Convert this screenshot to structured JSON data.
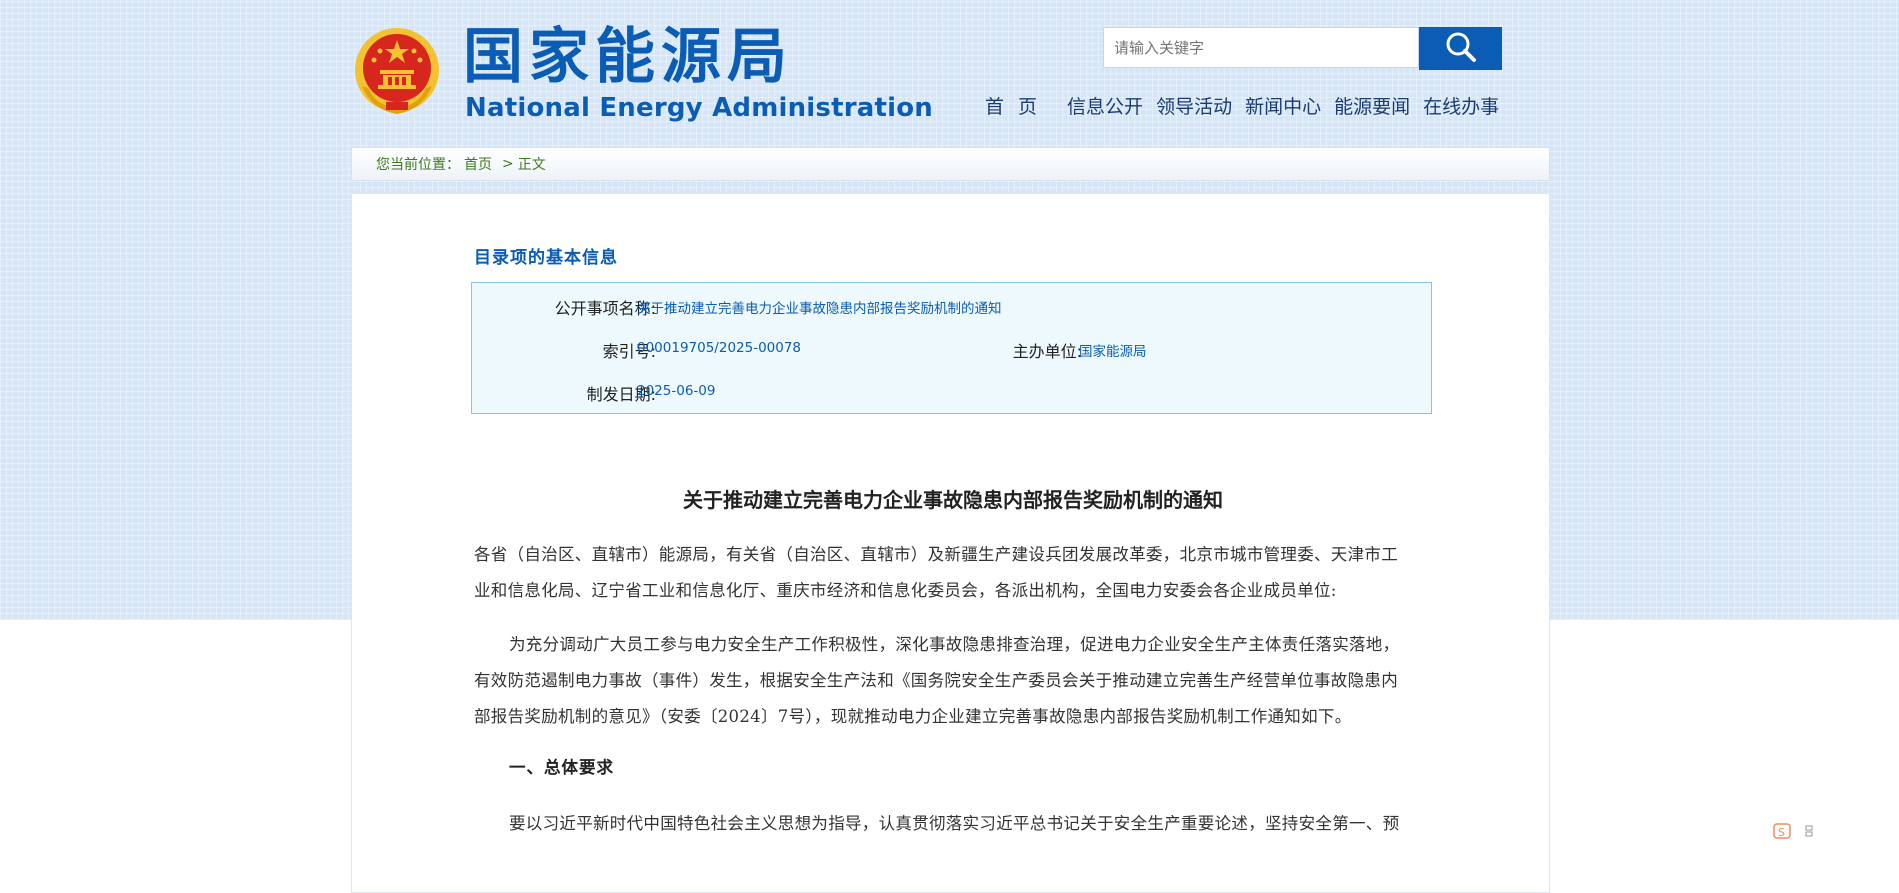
{
  "header": {
    "logo_cn": "国家能源局",
    "logo_en": "National Energy Administration",
    "search_placeholder": "请输入关键字",
    "nav": [
      "首 页",
      "信息公开",
      "领导活动",
      "新闻中心",
      "能源要闻",
      "在线办事"
    ]
  },
  "breadcrumb": {
    "prefix": "您当前位置：",
    "home": "首页",
    "separator": ">",
    "current": "正文"
  },
  "info": {
    "title": "目录项的基本信息",
    "name_label": "公开事项名称:",
    "name_value": "关于推动建立完善电力企业事故隐患内部报告奖励机制的通知",
    "index_label": "索引号:",
    "index_value": "000019705/2025-00078",
    "org_label": "主办单位:",
    "org_value": "国家能源局",
    "date_label": "制发日期:",
    "date_value": "2025-06-09"
  },
  "article": {
    "title": "关于推动建立完善电力企业事故隐患内部报告奖励机制的通知",
    "p1_line1": "各省（自治区、直辖市）能源局，有关省（自治区、直辖市）及新疆生产建设兵团发展改革委，北京市城市管理委、天津市工",
    "p1_line2": "业和信息化局、辽宁省工业和信息化厅、重庆市经济和信息化委员会，各派出机构，全国电力安委会各企业成员单位:",
    "p2_line1": "为充分调动广大员工参与电力安全生产工作积极性，深化事故隐患排查治理，促进电力企业安全生产主体责任落实落地，",
    "p2_line2": "有效防范遏制电力事故（事件）发生，根据安全生产法和《国务院安全生产委员会关于推动建立完善生产经营单位事故隐患内",
    "p2_line3": "部报告奖励机制的意见》（安委〔2024〕7号），现就推动电力企业建立完善事故隐患内部报告奖励机制工作通知如下。",
    "section1": "一、总体要求",
    "p3_line1": "要以习近平新时代中国特色社会主义思想为指导，认真贯彻落实习近平总书记关于安全生产重要论述，坚持安全第一、预"
  },
  "colors": {
    "brand_blue": "#0a5cb4",
    "emblem_red": "#d7261e",
    "emblem_gold": "#f2c230",
    "breadcrumb_green": "#3f7a1d"
  },
  "icons": {
    "search": "magnifier-icon",
    "emblem": "national-emblem",
    "corner": "sogou-input-icon"
  }
}
